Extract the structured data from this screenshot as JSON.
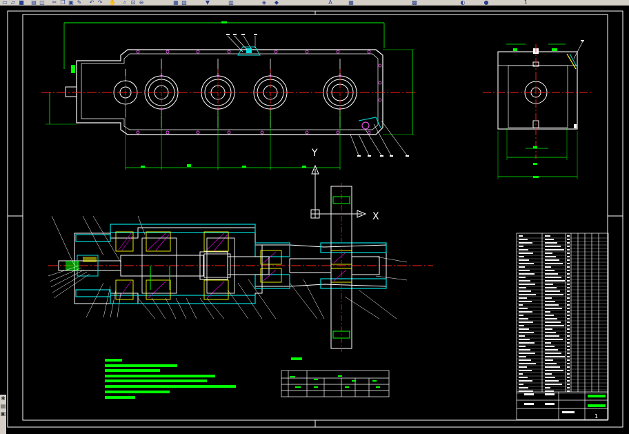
{
  "toolbar": {
    "icons": [
      "new-icon",
      "open-icon",
      "save-icon",
      "print-icon",
      "preview-icon",
      "cut-icon",
      "copy-icon",
      "paste-icon",
      "matchprop-icon",
      "undo-icon",
      "redo-icon",
      "pan-icon",
      "zoom-realtime-icon",
      "zoom-window-icon",
      "zoom-previous-icon",
      "properties-icon",
      "designcenter-icon",
      "toolpalette-icon",
      "calculator-icon",
      "layer-icon",
      "color-icon"
    ],
    "layer_value": "1"
  },
  "drawing": {
    "colors": {
      "frame": "#ffffff",
      "outline": "#ffffff",
      "dimension": "#00ff00",
      "center": "#ff2020",
      "section": "#00e0e0",
      "hatch": "#ff00ff",
      "yellow": "#ffff00",
      "highlight": "#00ff00"
    },
    "ucs": {
      "y_label": "Y",
      "x_label": "X"
    },
    "title_block": {
      "sheet": "1"
    }
  },
  "sidebar": {
    "icons": [
      "properties-icon",
      "layer-icon",
      "tool-icon"
    ]
  }
}
